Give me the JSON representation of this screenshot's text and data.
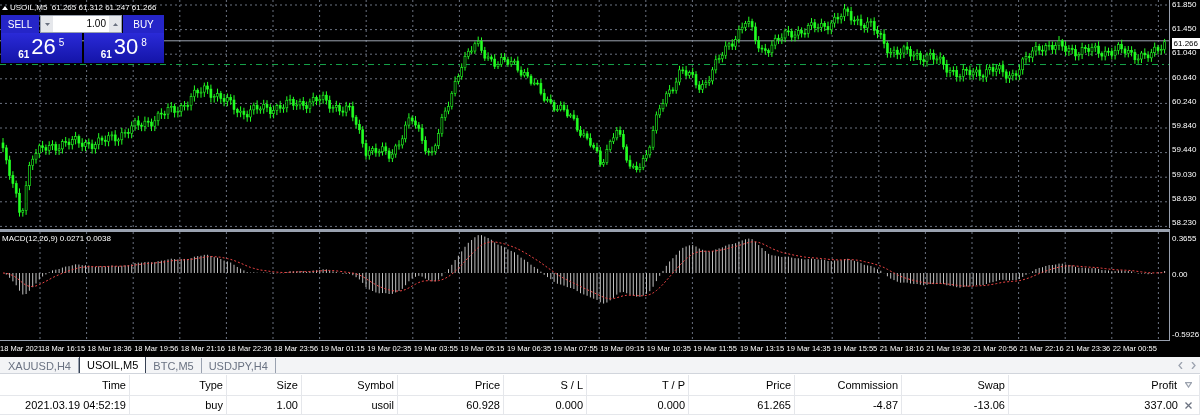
{
  "chart": {
    "title": "USOIL,M5  61.265 61.312 61.247 61.266",
    "one_click": {
      "sell_label": "SELL",
      "buy_label": "BUY",
      "volume": "1.00",
      "sell_price": {
        "prefix": "61",
        "main": "26",
        "sup": "5"
      },
      "buy_price": {
        "prefix": "61",
        "main": "30",
        "sup": "8"
      }
    },
    "price_axis": [
      "61.850",
      "61.450",
      "61.040",
      "60.640",
      "60.240",
      "59.840",
      "59.440",
      "59.030",
      "58.630",
      "58.230"
    ],
    "current_price": "61.266",
    "macd": {
      "label": "MACD(12,26,9) 0.0271 0.0038",
      "axis": [
        "0.3655",
        "0.00",
        "-0.5926"
      ]
    },
    "time_axis": [
      "18 Mar 2021",
      "18 Mar 16:15",
      "18 Mar 18:36",
      "18 Mar 19:56",
      "18 Mar 21:16",
      "18 Mar 22:36",
      "18 Mar 23:56",
      "19 Mar 01:15",
      "19 Mar 02:35",
      "19 Mar 03:55",
      "19 Mar 05:15",
      "19 Mar 06:35",
      "19 Mar 07:55",
      "19 Mar 09:15",
      "19 Mar 10:35",
      "19 Mar 11:55",
      "19 Mar 13:15",
      "19 Mar 14:35",
      "19 Mar 15:55",
      "21 Mar 18:16",
      "21 Mar 19:36",
      "21 Mar 20:56",
      "21 Mar 22:16",
      "21 Mar 23:36",
      "22 Mar 00:55"
    ]
  },
  "tabs": [
    {
      "label": "XAUUSD,H4",
      "selected": false
    },
    {
      "label": "USOIL,M5",
      "selected": true
    },
    {
      "label": "BTC,M5",
      "selected": false
    },
    {
      "label": "USDJPY,H4",
      "selected": false
    }
  ],
  "table": {
    "columns": [
      "Time",
      "Type",
      "Size",
      "Symbol",
      "Price",
      "S / L",
      "T / P",
      "Price",
      "Commission",
      "Swap",
      "Profit"
    ],
    "rows": [
      {
        "cells": [
          "2021.03.19 04:52:19",
          "buy",
          "1.00",
          "usoil",
          "60.928",
          "0.000",
          "0.000",
          "61.265",
          "-4.87",
          "-13.06",
          "337.00"
        ]
      }
    ]
  }
}
